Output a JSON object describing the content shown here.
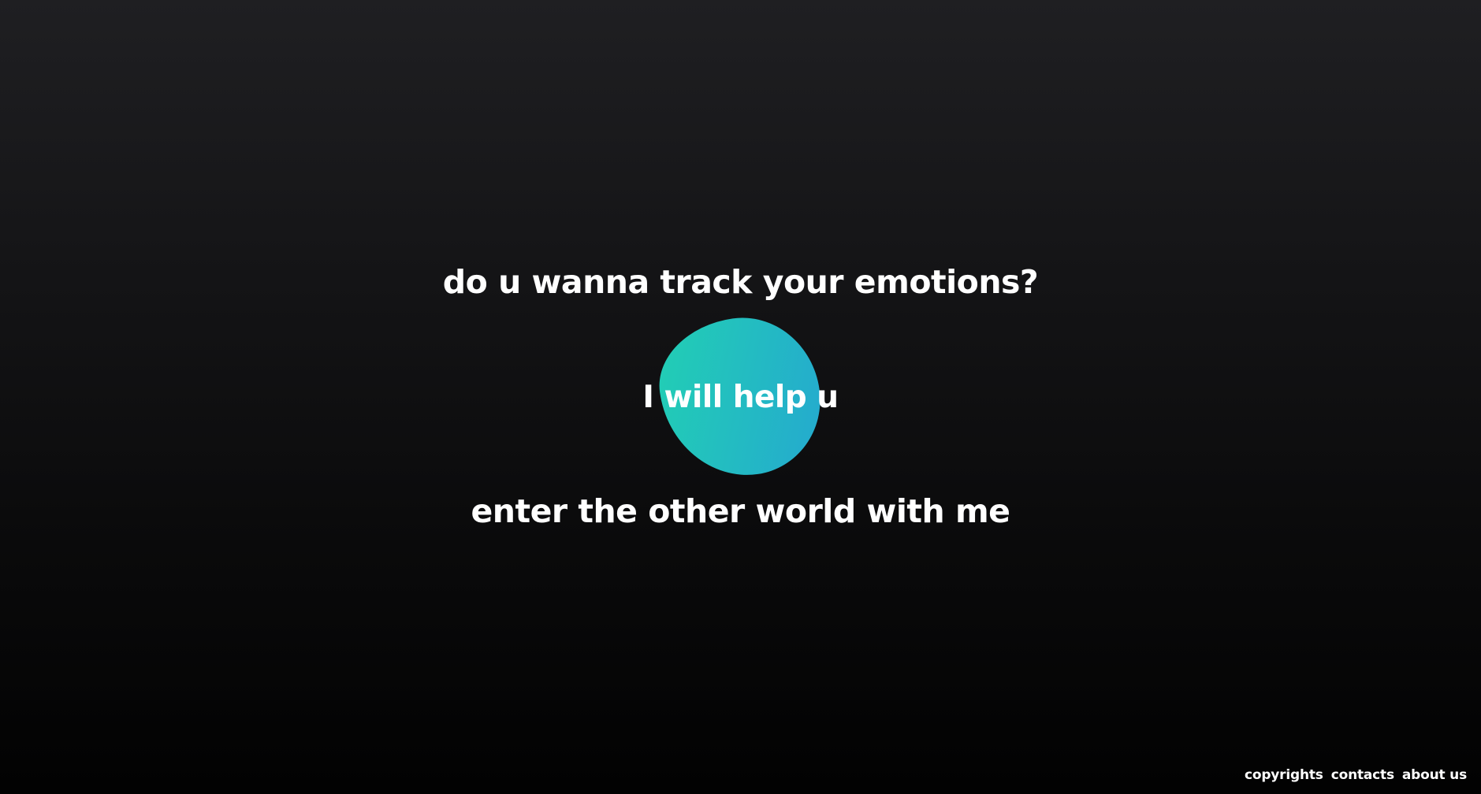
{
  "hero": {
    "line_1": "do u wanna track your emotions?",
    "line_2": "I will help u",
    "line_3": "enter the other world with me"
  },
  "blob": {
    "color_start": "#22d0b3",
    "color_end": "#24a8d0"
  },
  "footer": {
    "links": [
      "copyrights",
      "contacts",
      "about us"
    ]
  },
  "colors": {
    "background_top": "#1f1f22",
    "background_bottom": "#020202",
    "text": "#ffffff"
  }
}
